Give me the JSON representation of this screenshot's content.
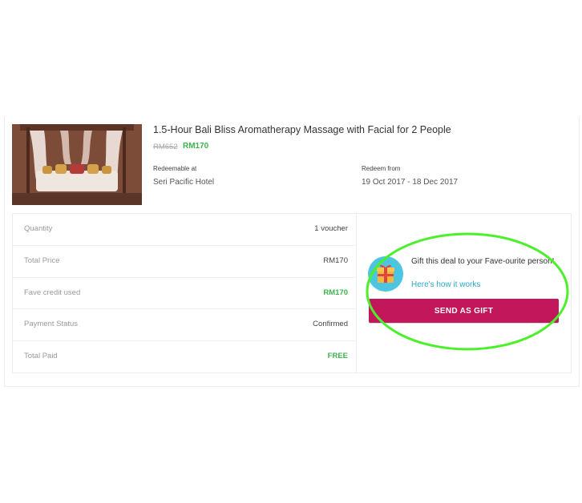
{
  "deal": {
    "title": "1.5-Hour Bali Bliss Aromatherapy Massage with Facial for 2 People",
    "original_price": "RM652",
    "price": "RM170",
    "redeemable_label": "Redeemable at",
    "redeemable_value": "Seri Pacific Hotel",
    "redeem_from_label": "Redeem from",
    "redeem_from_value": "19 Oct 2017 - 18 Dec 2017"
  },
  "summary": {
    "rows": [
      {
        "label": "Quantity",
        "value": "1 voucher"
      },
      {
        "label": "Total Price",
        "value": "RM170"
      },
      {
        "label": "Fave credit used",
        "value": "RM170"
      },
      {
        "label": "Payment Status",
        "value": "Confirmed"
      },
      {
        "label": "Total Paid",
        "value": "FREE"
      }
    ]
  },
  "gift": {
    "text": "Gift this deal to your Fave-ourite person!",
    "link": "Here's how it works",
    "button": "SEND AS GIFT",
    "icon": "gift-box-icon"
  },
  "colors": {
    "accent_green": "#3fb34f",
    "gift_button": "#c2185b",
    "link": "#2aa8c9",
    "annotation_circle": "#4cf02a"
  }
}
